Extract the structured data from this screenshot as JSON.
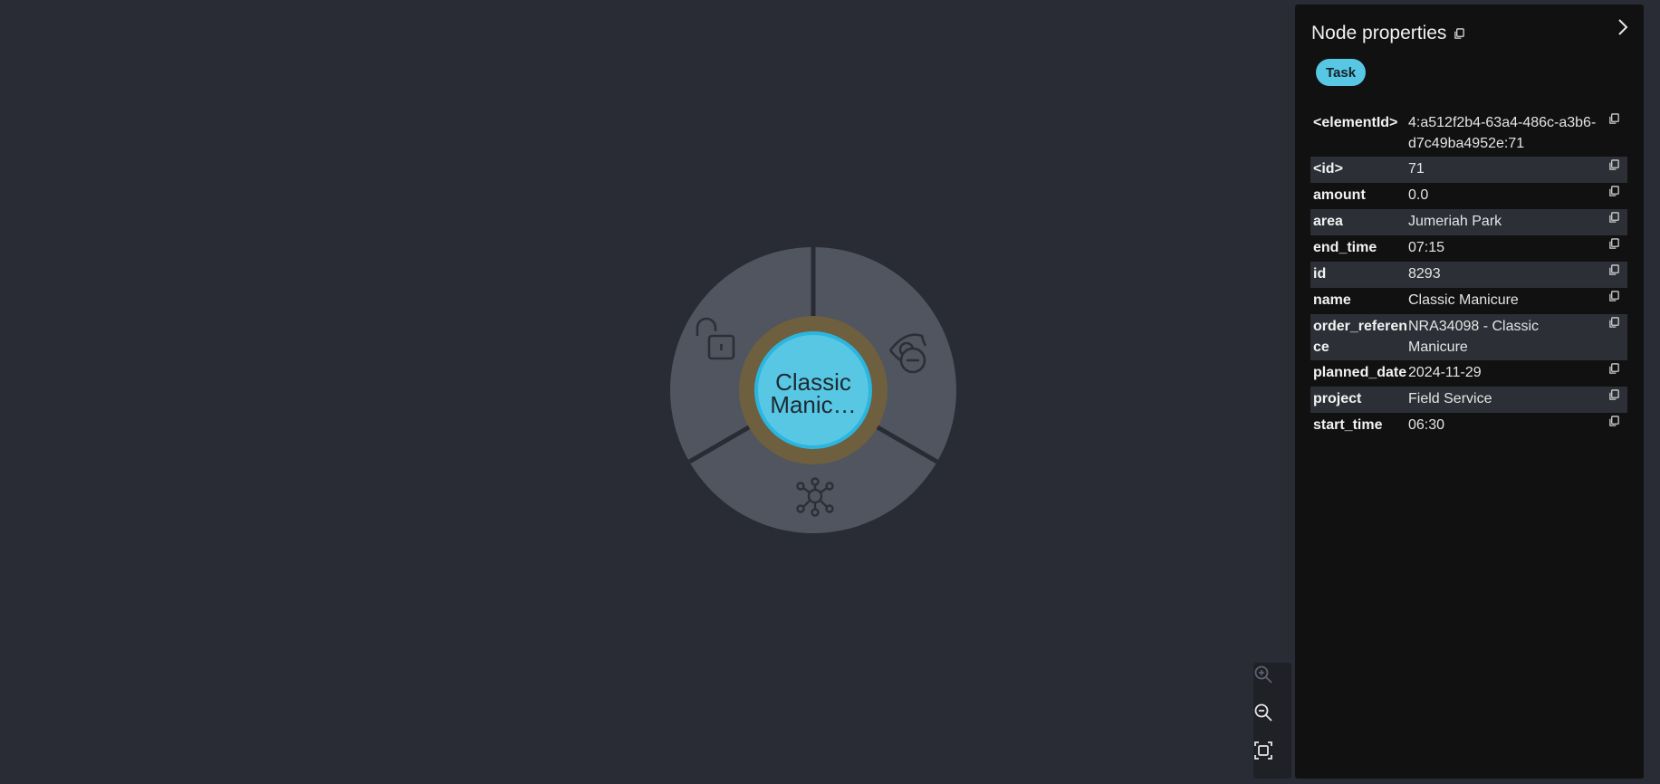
{
  "graph": {
    "node_label": "Classic Manic…",
    "node_label_lines": [
      "Classic",
      "Manic…"
    ],
    "node_color": "#57c7e3",
    "node_ring_color": "#6e5f3f",
    "menu": {
      "unlock_icon": "unlock-icon",
      "hide_icon": "eye-hide-icon",
      "expand_icon": "expand-neighbors-icon"
    }
  },
  "zoom": {
    "zoom_in_icon": "zoom-in-icon",
    "zoom_out_icon": "zoom-out-icon",
    "fit_icon": "fit-to-screen-icon"
  },
  "panel": {
    "title": "Node properties",
    "label_badge": "Task",
    "badge_color": "#57c7e3",
    "properties": [
      {
        "key": "<elementId>",
        "value": "4:a512f2b4-63a4-486c-a3b6-d7c49ba4952e:71"
      },
      {
        "key": "<id>",
        "value": "71"
      },
      {
        "key": "amount",
        "value": "0.0"
      },
      {
        "key": "area",
        "value": "Jumeriah Park"
      },
      {
        "key": "end_time",
        "value": "07:15"
      },
      {
        "key": "id",
        "value": "8293"
      },
      {
        "key": "name",
        "value": "Classic Manicure"
      },
      {
        "key": "order_reference",
        "value": "NRA34098 - Classic Manicure"
      },
      {
        "key": "planned_date",
        "value": "2024-11-29"
      },
      {
        "key": "project",
        "value": "Field Service"
      },
      {
        "key": "start_time",
        "value": "06:30"
      }
    ]
  }
}
